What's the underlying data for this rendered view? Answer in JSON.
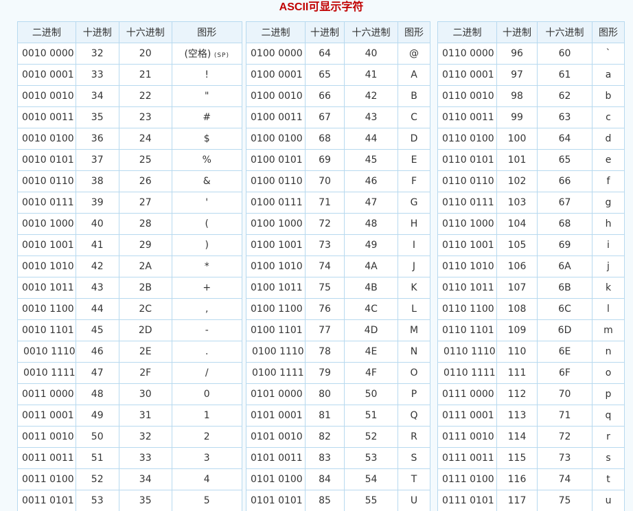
{
  "title": "ASCII可显示字符",
  "headers": [
    "二进制",
    "十进制",
    "十六进制",
    "图形"
  ],
  "space_label": "(空格)",
  "space_abbr": "(SP)",
  "tables": [
    {
      "rows": [
        [
          "0010 0000",
          "32",
          "20",
          ""
        ],
        [
          "0010 0001",
          "33",
          "21",
          "!"
        ],
        [
          "0010 0010",
          "34",
          "22",
          "\""
        ],
        [
          "0010 0011",
          "35",
          "23",
          "#"
        ],
        [
          "0010 0100",
          "36",
          "24",
          "$"
        ],
        [
          "0010 0101",
          "37",
          "25",
          "%"
        ],
        [
          "0010 0110",
          "38",
          "26",
          "&"
        ],
        [
          "0010 0111",
          "39",
          "27",
          "'"
        ],
        [
          "0010 1000",
          "40",
          "28",
          "("
        ],
        [
          "0010 1001",
          "41",
          "29",
          ")"
        ],
        [
          "0010 1010",
          "42",
          "2A",
          "*"
        ],
        [
          "0010 1011",
          "43",
          "2B",
          "+"
        ],
        [
          "0010 1100",
          "44",
          "2C",
          ","
        ],
        [
          "0010 1101",
          "45",
          "2D",
          "-"
        ],
        [
          "0010 1110",
          "46",
          "2E",
          "."
        ],
        [
          "0010 1111",
          "47",
          "2F",
          "/"
        ],
        [
          "0011 0000",
          "48",
          "30",
          "0"
        ],
        [
          "0011 0001",
          "49",
          "31",
          "1"
        ],
        [
          "0011 0010",
          "50",
          "32",
          "2"
        ],
        [
          "0011 0011",
          "51",
          "33",
          "3"
        ],
        [
          "0011 0100",
          "52",
          "34",
          "4"
        ],
        [
          "0011 0101",
          "53",
          "35",
          "5"
        ]
      ]
    },
    {
      "rows": [
        [
          "0100 0000",
          "64",
          "40",
          "@"
        ],
        [
          "0100 0001",
          "65",
          "41",
          "A"
        ],
        [
          "0100 0010",
          "66",
          "42",
          "B"
        ],
        [
          "0100 0011",
          "67",
          "43",
          "C"
        ],
        [
          "0100 0100",
          "68",
          "44",
          "D"
        ],
        [
          "0100 0101",
          "69",
          "45",
          "E"
        ],
        [
          "0100 0110",
          "70",
          "46",
          "F"
        ],
        [
          "0100 0111",
          "71",
          "47",
          "G"
        ],
        [
          "0100 1000",
          "72",
          "48",
          "H"
        ],
        [
          "0100 1001",
          "73",
          "49",
          "I"
        ],
        [
          "0100 1010",
          "74",
          "4A",
          "J"
        ],
        [
          "0100 1011",
          "75",
          "4B",
          "K"
        ],
        [
          "0100 1100",
          "76",
          "4C",
          "L"
        ],
        [
          "0100 1101",
          "77",
          "4D",
          "M"
        ],
        [
          "0100 1110",
          "78",
          "4E",
          "N"
        ],
        [
          "0100 1111",
          "79",
          "4F",
          "O"
        ],
        [
          "0101 0000",
          "80",
          "50",
          "P"
        ],
        [
          "0101 0001",
          "81",
          "51",
          "Q"
        ],
        [
          "0101 0010",
          "82",
          "52",
          "R"
        ],
        [
          "0101 0011",
          "83",
          "53",
          "S"
        ],
        [
          "0101 0100",
          "84",
          "54",
          "T"
        ],
        [
          "0101 0101",
          "85",
          "55",
          "U"
        ]
      ]
    },
    {
      "rows": [
        [
          "0110 0000",
          "96",
          "60",
          "`"
        ],
        [
          "0110 0001",
          "97",
          "61",
          "a"
        ],
        [
          "0110 0010",
          "98",
          "62",
          "b"
        ],
        [
          "0110 0011",
          "99",
          "63",
          "c"
        ],
        [
          "0110 0100",
          "100",
          "64",
          "d"
        ],
        [
          "0110 0101",
          "101",
          "65",
          "e"
        ],
        [
          "0110 0110",
          "102",
          "66",
          "f"
        ],
        [
          "0110 0111",
          "103",
          "67",
          "g"
        ],
        [
          "0110 1000",
          "104",
          "68",
          "h"
        ],
        [
          "0110 1001",
          "105",
          "69",
          "i"
        ],
        [
          "0110 1010",
          "106",
          "6A",
          "j"
        ],
        [
          "0110 1011",
          "107",
          "6B",
          "k"
        ],
        [
          "0110 1100",
          "108",
          "6C",
          "l"
        ],
        [
          "0110 1101",
          "109",
          "6D",
          "m"
        ],
        [
          "0110 1110",
          "110",
          "6E",
          "n"
        ],
        [
          "0110 1111",
          "111",
          "6F",
          "o"
        ],
        [
          "0111 0000",
          "112",
          "70",
          "p"
        ],
        [
          "0111 0001",
          "113",
          "71",
          "q"
        ],
        [
          "0111 0010",
          "114",
          "72",
          "r"
        ],
        [
          "0111 0011",
          "115",
          "73",
          "s"
        ],
        [
          "0111 0100",
          "116",
          "74",
          "t"
        ],
        [
          "0111 0101",
          "117",
          "75",
          "u"
        ]
      ]
    }
  ]
}
